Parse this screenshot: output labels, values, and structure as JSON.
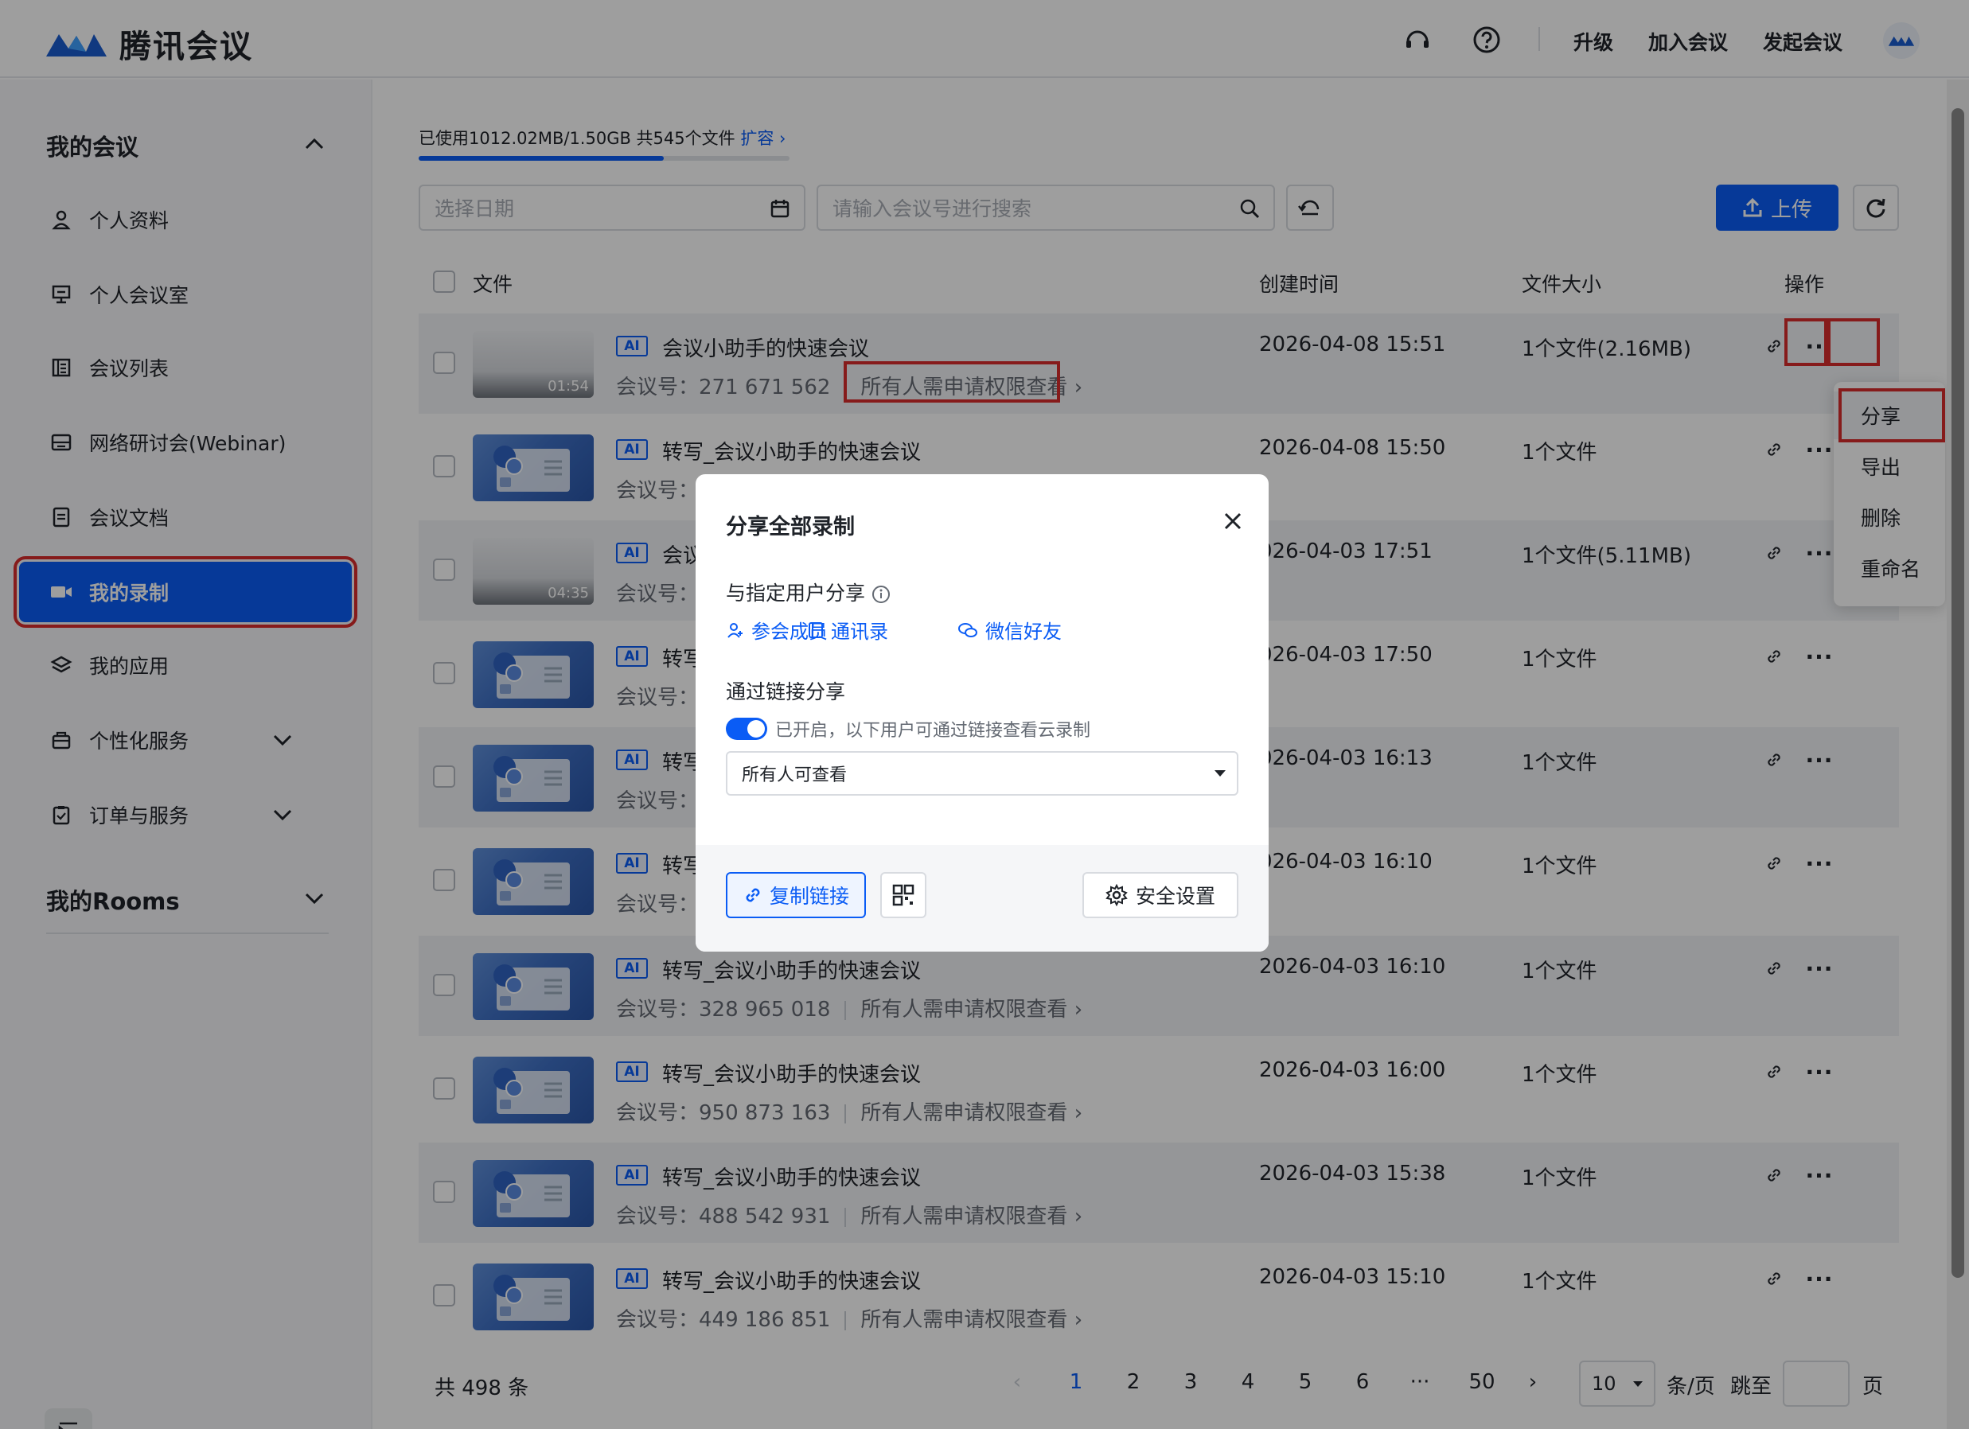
{
  "header": {
    "app_name": "腾讯会议",
    "upgrade": "升级",
    "join": "加入会议",
    "start": "发起会议"
  },
  "sidebar": {
    "my_meetings": "我的会议",
    "items": [
      {
        "label": "个人资料",
        "icon": "user-icon"
      },
      {
        "label": "个人会议室",
        "icon": "meeting-room-icon"
      },
      {
        "label": "会议列表",
        "icon": "list-icon"
      },
      {
        "label": "网络研讨会(Webinar)",
        "icon": "webinar-icon"
      },
      {
        "label": "会议文档",
        "icon": "document-icon"
      },
      {
        "label": "我的录制",
        "icon": "video-icon",
        "active": true
      },
      {
        "label": "我的应用",
        "icon": "layers-icon"
      },
      {
        "label": "个性化服务",
        "icon": "service-icon"
      },
      {
        "label": "订单与服务",
        "icon": "order-icon"
      }
    ],
    "rooms": "我的Rooms"
  },
  "storage": {
    "text": "已使用1012.02MB/1.50GB  共545个文件",
    "expand": "扩容",
    "used_fraction": 0.66
  },
  "filters": {
    "date_placeholder": "选择日期",
    "search_placeholder": "请输入会议号进行搜索",
    "upload": "上传"
  },
  "table": {
    "headers": {
      "file": "文件",
      "created": "创建时间",
      "size": "文件大小",
      "actions": "操作"
    },
    "rows": [
      {
        "title": "会议小助手的快速会议",
        "meeting_id": "会议号：271 671 562",
        "perm": "所有人需申请权限查看",
        "date": "2026-04-08 15:51",
        "size": "1个文件(2.16MB)",
        "thumb": "video",
        "duration": "01:54"
      },
      {
        "title": "转写_会议小助手的快速会议",
        "meeting_id": "会议号：",
        "perm": "",
        "date": "2026-04-08 15:50",
        "size": "1个文件",
        "thumb": "transcript"
      },
      {
        "title": "会议",
        "meeting_id": "会议号：",
        "perm": "",
        "date": "026-04-03 17:51",
        "size": "1个文件(5.11MB)",
        "thumb": "video",
        "duration": "04:35"
      },
      {
        "title": "转写",
        "meeting_id": "会议号：",
        "perm": "",
        "date": "026-04-03 17:50",
        "size": "1个文件",
        "thumb": "transcript"
      },
      {
        "title": "转写",
        "meeting_id": "会议号：",
        "perm": "",
        "date": "026-04-03 16:13",
        "size": "1个文件",
        "thumb": "transcript"
      },
      {
        "title": "转写",
        "meeting_id": "会议号：",
        "perm": "",
        "date": "026-04-03 16:10",
        "size": "1个文件",
        "thumb": "transcript"
      },
      {
        "title": "转写_会议小助手的快速会议",
        "meeting_id": "会议号：328 965 018",
        "perm": "所有人需申请权限查看",
        "date": "2026-04-03 16:10",
        "size": "1个文件",
        "thumb": "transcript"
      },
      {
        "title": "转写_会议小助手的快速会议",
        "meeting_id": "会议号：950 873 163",
        "perm": "所有人需申请权限查看",
        "date": "2026-04-03 16:00",
        "size": "1个文件",
        "thumb": "transcript"
      },
      {
        "title": "转写_会议小助手的快速会议",
        "meeting_id": "会议号：488 542 931",
        "perm": "所有人需申请权限查看",
        "date": "2026-04-03 15:38",
        "size": "1个文件",
        "thumb": "transcript"
      },
      {
        "title": "转写_会议小助手的快速会议",
        "meeting_id": "会议号：449 186 851",
        "perm": "所有人需申请权限查看",
        "date": "2026-04-03 15:10",
        "size": "1个文件",
        "thumb": "transcript"
      }
    ]
  },
  "dropdown": {
    "items": [
      "分享",
      "导出",
      "删除",
      "重命名"
    ]
  },
  "modal": {
    "title": "分享全部录制",
    "specific_share": "与指定用户分享",
    "opt_participants": "参会成员",
    "opt_contacts": "通讯录",
    "opt_wechat": "微信好友",
    "link_share": "通过链接分享",
    "toggle_text": "已开启，以下用户可通过链接查看云录制",
    "permission": "所有人可查看",
    "copy_link": "复制链接",
    "security": "安全设置"
  },
  "pagination": {
    "total": "共 498 条",
    "pages": [
      "1",
      "2",
      "3",
      "4",
      "5",
      "6",
      "···",
      "50"
    ],
    "current": "1",
    "page_size": "10",
    "per_page": "条/页",
    "jump": "跳至",
    "page_unit": "页"
  },
  "colors": {
    "accent": "#0a5cf5",
    "highlight": "#d92c2c"
  }
}
